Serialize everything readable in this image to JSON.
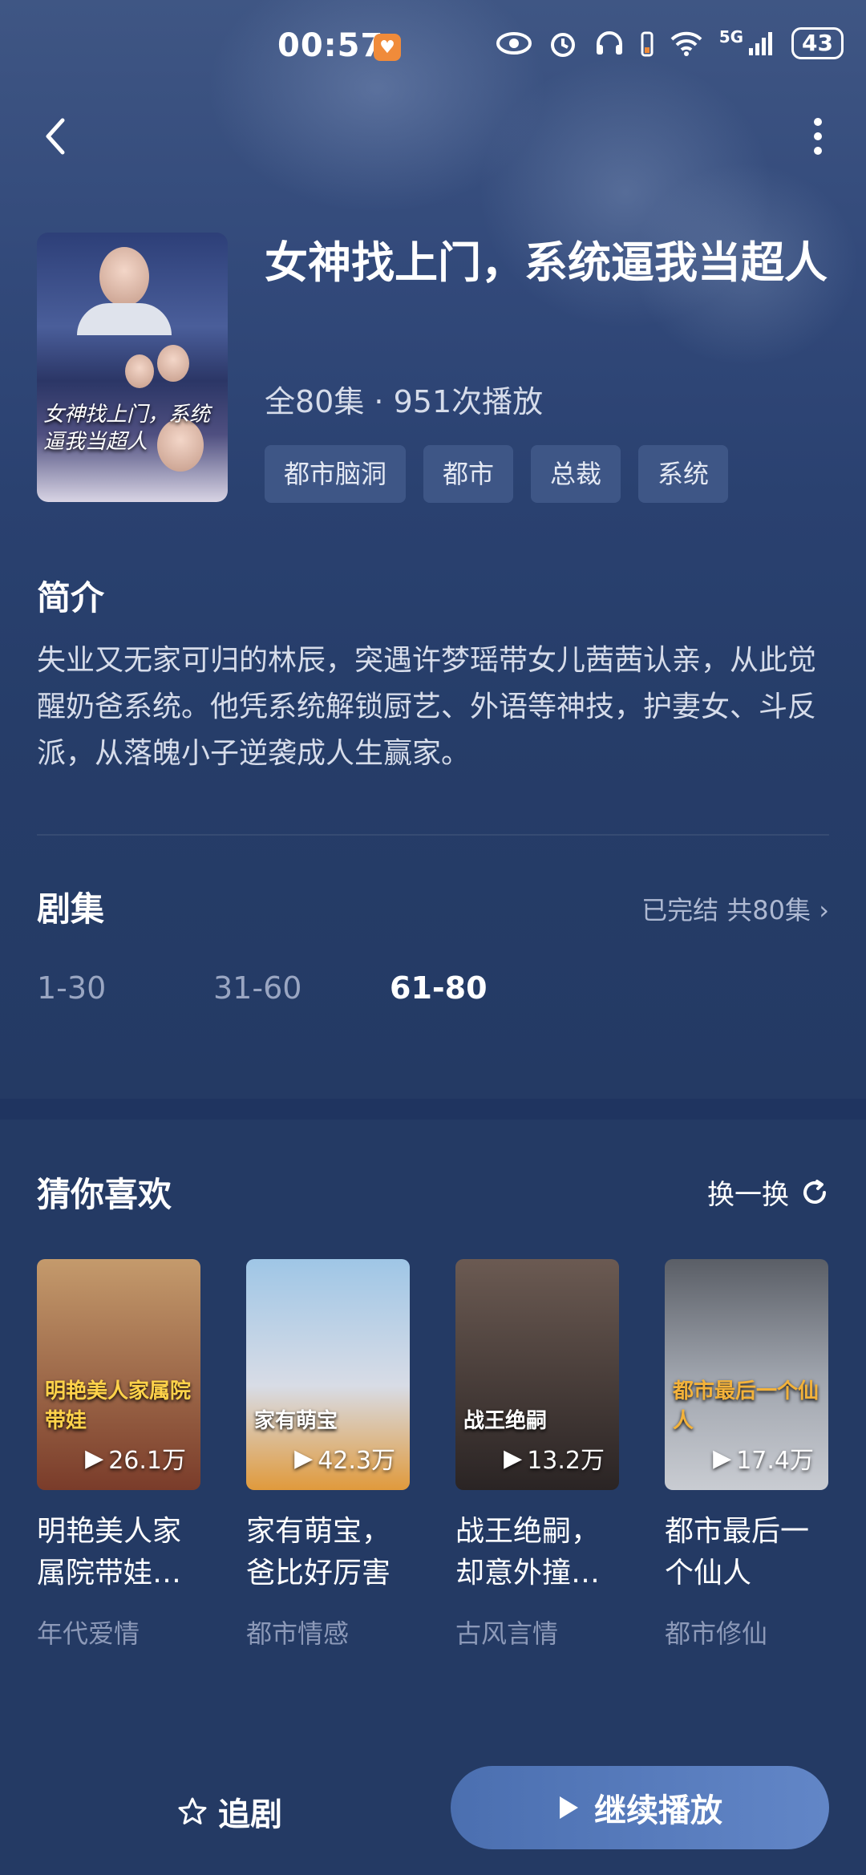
{
  "status_bar": {
    "time": "00:57",
    "battery": "43",
    "network": "5G"
  },
  "show": {
    "title": "女神找上门，系统逼我当超人",
    "meta": "全80集 · 951次播放",
    "tags": [
      "都市脑洞",
      "都市",
      "总裁",
      "系统"
    ],
    "poster_art_text": "女神找上门，系统逼我当超人"
  },
  "intro": {
    "heading": "简介",
    "text": "失业又无家可归的林辰，突遇许梦瑶带女儿茜茜认亲，从此觉醒奶爸系统。他凭系统解锁厨艺、外语等神技，护妻女、斗反派，从落魄小子逆袭成人生赢家。"
  },
  "episodes": {
    "heading": "剧集",
    "status": "已完结 共80集",
    "ranges": [
      "1-30",
      "31-60",
      "61-80"
    ],
    "active_range": "61-80"
  },
  "recommend": {
    "heading": "猜你喜欢",
    "refresh_label": "换一换",
    "items": [
      {
        "title": "明艳美人家属院带娃…",
        "genre": "年代爱情",
        "plays": "26.1万",
        "art_text": "明艳美人家属院带娃",
        "color_top": "#c49a6c",
        "color_bottom": "#7a3c2a"
      },
      {
        "title": "家有萌宝，爸比好厉害",
        "genre": "都市情感",
        "plays": "42.3万",
        "art_text": "家有萌宝",
        "color_top": "#9fc6e6",
        "color_bottom": "#e09a3c"
      },
      {
        "title": "战王绝嗣，却意外撞…",
        "genre": "古风言情",
        "plays": "13.2万",
        "art_text": "战王绝嗣",
        "color_top": "#6b5a52",
        "color_bottom": "#2a2424"
      },
      {
        "title": "都市最后一个仙人",
        "genre": "都市修仙",
        "plays": "17.4万",
        "art_text": "都市最后一个仙人",
        "color_top": "#5a5e66",
        "color_bottom": "#c9ccd2"
      }
    ]
  },
  "bottom_bar": {
    "follow_label": "追剧",
    "play_label": "继续播放"
  }
}
